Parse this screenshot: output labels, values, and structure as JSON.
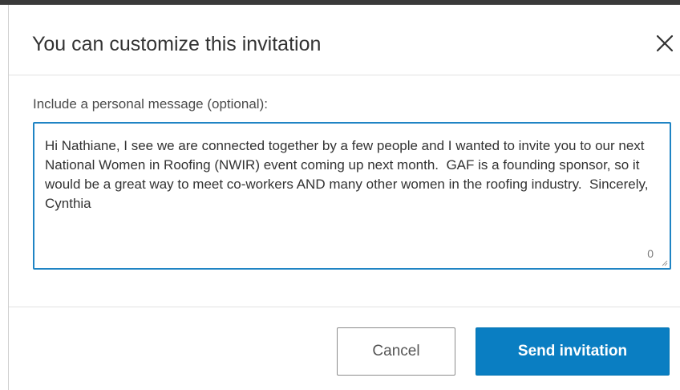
{
  "dialog": {
    "title": "You can customize this invitation",
    "close_icon": "close-icon"
  },
  "message": {
    "label": "Include a personal message (optional):",
    "value": "Hi Nathiane, I see we are connected together by a few people and I wanted to invite you to our next National Women in Roofing (NWIR) event coming up next month.  GAF is a founding sponsor, so it would be a great way to meet co-workers AND many other women in the roofing industry.  Sincerely, Cynthia",
    "char_count": "0"
  },
  "actions": {
    "cancel_label": "Cancel",
    "send_label": "Send invitation"
  },
  "colors": {
    "accent": "#0a7ec2",
    "focus_border": "#1f84c4"
  }
}
